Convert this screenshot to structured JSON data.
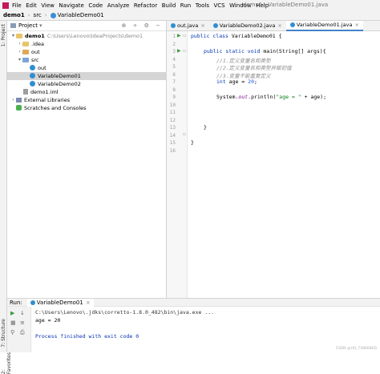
{
  "menubar": {
    "items": [
      "File",
      "Edit",
      "View",
      "Navigate",
      "Code",
      "Analyze",
      "Refactor",
      "Build",
      "Run",
      "Tools",
      "VCS",
      "Window",
      "Help"
    ],
    "window_title": "demo1 - VariableDemo01.java"
  },
  "breadcrumb": [
    "demo1",
    "src",
    "VariableDemo01"
  ],
  "left_stripe": {
    "project": "1: Project",
    "structure": "7: Structure",
    "favorites": "2: Favorites"
  },
  "project_panel": {
    "title": "Project",
    "tree": [
      {
        "label": "demo1",
        "path": "C:\\Users\\Lenovo\\IdeaProjects\\demo1",
        "icon": "folder-module",
        "arrow": "down"
      },
      {
        "label": ".idea",
        "icon": "folder",
        "arrow": "right"
      },
      {
        "label": "out",
        "icon": "folder",
        "arrow": "down"
      },
      {
        "label": "src",
        "icon": "folder-blue",
        "arrow": "down"
      },
      {
        "label": "out",
        "icon": "class"
      },
      {
        "label": "VariableDemo01",
        "icon": "class",
        "selected": true
      },
      {
        "label": "VariableDemo02",
        "icon": "class"
      },
      {
        "label": "demo1.iml",
        "icon": "file"
      },
      {
        "label": "External Libraries",
        "icon": "library",
        "arrow": "right"
      },
      {
        "label": "Scratches and Consoles",
        "icon": "scratch"
      }
    ]
  },
  "editor": {
    "tabs": [
      {
        "label": "out.java",
        "active": false
      },
      {
        "label": "VariableDemo02.java",
        "active": false
      },
      {
        "label": "VariableDemo01.java",
        "active": true
      }
    ],
    "line_numbers": [
      "1",
      "2",
      "3",
      "4",
      "5",
      "6",
      "7",
      "8",
      "9",
      "10",
      "11",
      "12",
      "13",
      "14",
      "15",
      "16"
    ],
    "code": {
      "l1_kw": "public class",
      "l1_rest": " VariableDemo01 {",
      "l3_kw": "public static void",
      "l3_rest": " main(String[] args){",
      "l4": "//1.定义变量名和类型",
      "l5": "//2.定义变量名和类型并赋初值",
      "l6": "//3.变量不能重复定义",
      "l7_kw": "int",
      "l7_mid": " age = ",
      "l7_num": "20",
      "l7_end": ";",
      "l9_a": "System.",
      "l9_out": "out",
      "l9_b": ".println(",
      "l9_str": "\"age = \"",
      "l9_c": " + age);",
      "l13": "}",
      "l15": "}"
    }
  },
  "run_panel": {
    "label": "Run:",
    "tab": "VariableDemo01",
    "console": [
      "C:\\Users\\Lenovo\\.jdks\\corretto-1.8.0_482\\bin\\java.exe ...",
      "age = 20",
      "",
      "Process finished with exit code 0"
    ]
  },
  "watermark": "CSDN @HO_T48668ED",
  "colors": {
    "keyword": "#0033b3",
    "comment": "#8c8c8c",
    "string": "#067d17",
    "number": "#1750eb",
    "run_green": "#3c9b3c"
  }
}
